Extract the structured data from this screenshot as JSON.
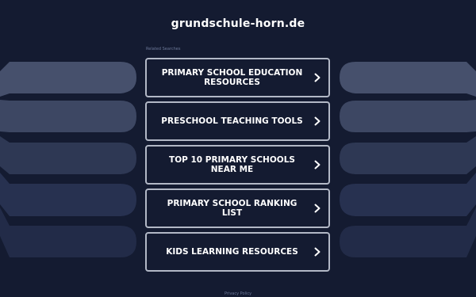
{
  "domain": "grundschule-horn.de",
  "related_label": "Related Searches",
  "items": [
    {
      "label": "PRIMARY SCHOOL EDUCATION RESOURCES",
      "icon": "chevron-right-icon"
    },
    {
      "label": "PRESCHOOL TEACHING TOOLS",
      "icon": "chevron-right-icon"
    },
    {
      "label": "TOP 10 PRIMARY SCHOOLS NEAR ME",
      "icon": "chevron-right-icon"
    },
    {
      "label": "PRIMARY SCHOOL RANKING LIST",
      "icon": "chevron-right-icon"
    },
    {
      "label": "KIDS LEARNING RESOURCES",
      "icon": "chevron-right-icon"
    }
  ],
  "privacy_label": "Privacy Policy",
  "colors": {
    "background": "#141b31",
    "band_1": "#46506c",
    "band_2": "#3d4763",
    "band_3": "#2e3854",
    "band_4": "#273150",
    "band_5": "#222b48",
    "border": "#b2b8c6",
    "text": "#ffffff"
  }
}
